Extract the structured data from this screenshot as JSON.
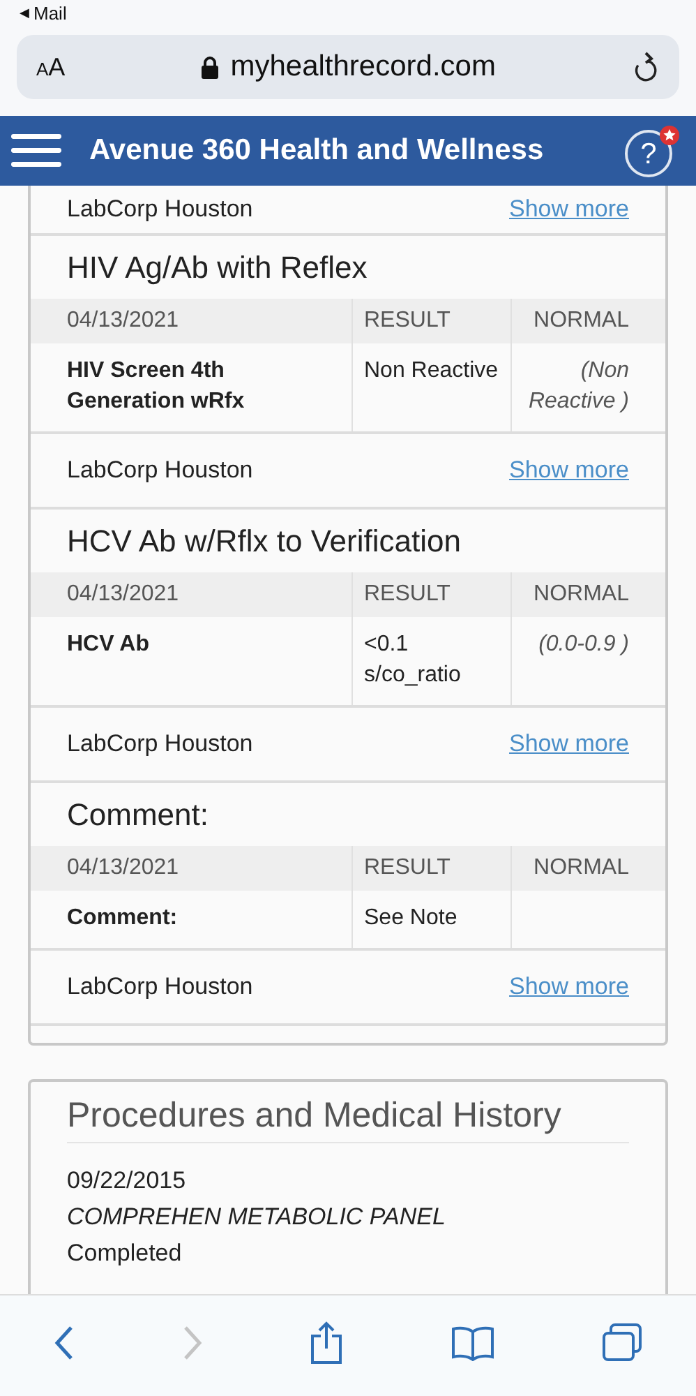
{
  "status_bar": {
    "back_arrow": "◀",
    "back_label": "Mail"
  },
  "address_bar": {
    "text_size_small": "A",
    "text_size_large": "A",
    "url": "myhealthrecord.com"
  },
  "header": {
    "title": "Avenue 360 Health and Wellness",
    "help_symbol": "?",
    "help_badge": true
  },
  "top_footer": {
    "lab": "LabCorp Houston",
    "link": "Show more"
  },
  "lab_sections": [
    {
      "title": "HIV Ag/Ab with Reflex",
      "date": "04/13/2021",
      "result_header": "RESULT",
      "normal_header": "NORMAL",
      "rows": [
        {
          "test": "HIV Screen 4th Generation wRfx",
          "result": "Non Reactive",
          "normal": "(Non Reactive )"
        }
      ],
      "lab": "LabCorp Houston",
      "link": "Show more"
    },
    {
      "title": "HCV Ab w/Rflx to Verification",
      "date": "04/13/2021",
      "result_header": "RESULT",
      "normal_header": "NORMAL",
      "rows": [
        {
          "test": "HCV Ab",
          "result": "<0.1 s/co_ratio",
          "normal": "(0.0-0.9 )"
        }
      ],
      "lab": "LabCorp Houston",
      "link": "Show more"
    },
    {
      "title": "Comment:",
      "date": "04/13/2021",
      "result_header": "RESULT",
      "normal_header": "NORMAL",
      "rows": [
        {
          "test": "Comment:",
          "result": "See Note"
        }
      ],
      "lab": "LabCorp Houston",
      "link": "Show more"
    }
  ],
  "procedures": {
    "title": "Procedures and Medical History",
    "items": [
      {
        "date": "09/22/2015",
        "name": "COMPREHEN METABOLIC PANEL",
        "status": "Completed"
      }
    ]
  },
  "toolbar": {
    "back_enabled": true,
    "forward_enabled": false
  }
}
